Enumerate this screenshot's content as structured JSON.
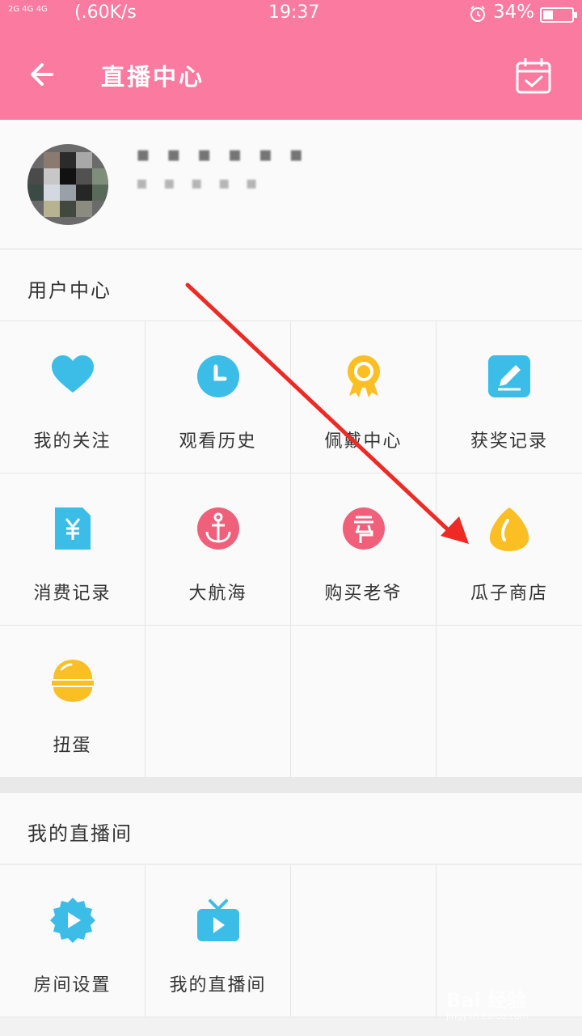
{
  "status_bar": {
    "signal": "2G 4G 4G",
    "speed": "(.60K/s",
    "time": "19:37",
    "battery": "34%"
  },
  "header": {
    "title": "直播中心",
    "back_icon": "back-arrow-icon",
    "calendar_icon": "calendar-check-icon"
  },
  "profile": {
    "name_masked": "▪ ▪ ▪ ▪ ▪ ▪",
    "sub_masked": "▪ ▪ ▪ ▪ ▪"
  },
  "user_center": {
    "title": "用户中心",
    "items": [
      {
        "label": "我的关注",
        "icon": "heart-icon",
        "color": "#3bbde8"
      },
      {
        "label": "观看历史",
        "icon": "clock-icon",
        "color": "#3bbde8"
      },
      {
        "label": "佩戴中心",
        "icon": "medal-icon",
        "color": "#fbbf24"
      },
      {
        "label": "获奖记录",
        "icon": "edit-icon",
        "color": "#3bbde8"
      },
      {
        "label": "消费记录",
        "icon": "yuan-receipt-icon",
        "color": "#3bbde8"
      },
      {
        "label": "大航海",
        "icon": "anchor-icon",
        "color": "#f0607a"
      },
      {
        "label": "购买老爷",
        "icon": "lord-badge-icon",
        "color": "#f0607a"
      },
      {
        "label": "瓜子商店",
        "icon": "seed-icon",
        "color": "#fbbf24"
      },
      {
        "label": "扭蛋",
        "icon": "capsule-icon",
        "color": "#fbbf24"
      }
    ]
  },
  "my_room": {
    "title": "我的直播间",
    "items": [
      {
        "label": "房间设置",
        "icon": "gear-play-icon",
        "color": "#3bbde8"
      },
      {
        "label": "我的直播间",
        "icon": "tv-icon",
        "color": "#3bbde8"
      }
    ]
  },
  "watermark": {
    "main": "Bai 经验",
    "sub": "jingyan.baidu.com"
  }
}
